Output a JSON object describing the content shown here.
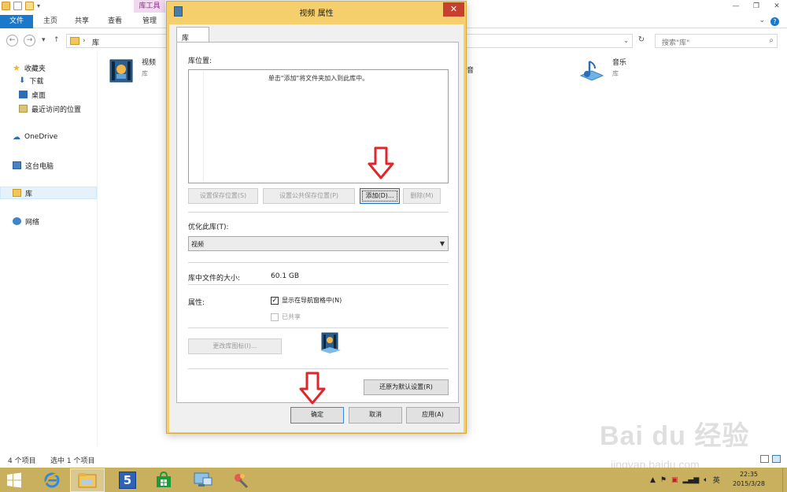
{
  "explorer": {
    "context_tab": "库工具",
    "ribbon_tabs": [
      "文件",
      "主页",
      "共享",
      "查看",
      "管理"
    ],
    "address": "库",
    "search_placeholder": "搜索\"库\"",
    "sidebar": {
      "favorites": "收藏夹",
      "downloads": "下载",
      "desktop": "桌面",
      "recent": "最近访问的位置",
      "onedrive": "OneDrive",
      "this_pc": "这台电脑",
      "libraries": "库",
      "network": "网络"
    },
    "items": [
      {
        "name": "视频",
        "type": "库"
      },
      {
        "name": "音乐",
        "type": "库"
      }
    ],
    "status_count": "4 个项目",
    "status_selected": "选中 1 个项目",
    "partial_text": "音"
  },
  "dialog": {
    "title": "视频 属性",
    "tab": "库",
    "locations_label": "库位置:",
    "locations_hint": "单击\"添加\"将文件夹加入到此库中。",
    "btn_set_save": "设置保存位置(S)",
    "btn_set_public": "设置公共保存位置(P)",
    "btn_add": "添加(D)...",
    "btn_remove": "删除(M)",
    "optimize_label": "优化此库(T):",
    "optimize_value": "视频",
    "size_label": "库中文件的大小:",
    "size_value": "60.1 GB",
    "attributes_label": "属性:",
    "show_nav": "显示在导航窗格中(N)",
    "shared": "已共享",
    "btn_change_icon": "更改库图标(I)...",
    "btn_restore": "还原为默认设置(R)",
    "btn_ok": "确定",
    "btn_cancel": "取消",
    "btn_apply": "应用(A)"
  },
  "taskbar": {
    "time": "22:35",
    "date": "2015/3/28",
    "ime": "英"
  },
  "watermark": {
    "main": "Bai du 经验",
    "sub": "jingyan.baidu.com"
  },
  "colors": {
    "ribbon_file": "#1979ca",
    "dialog_frame": "#f4cf6b",
    "taskbar": "#c9b05f",
    "close": "#c7402f",
    "arrow": "#e0262a"
  }
}
